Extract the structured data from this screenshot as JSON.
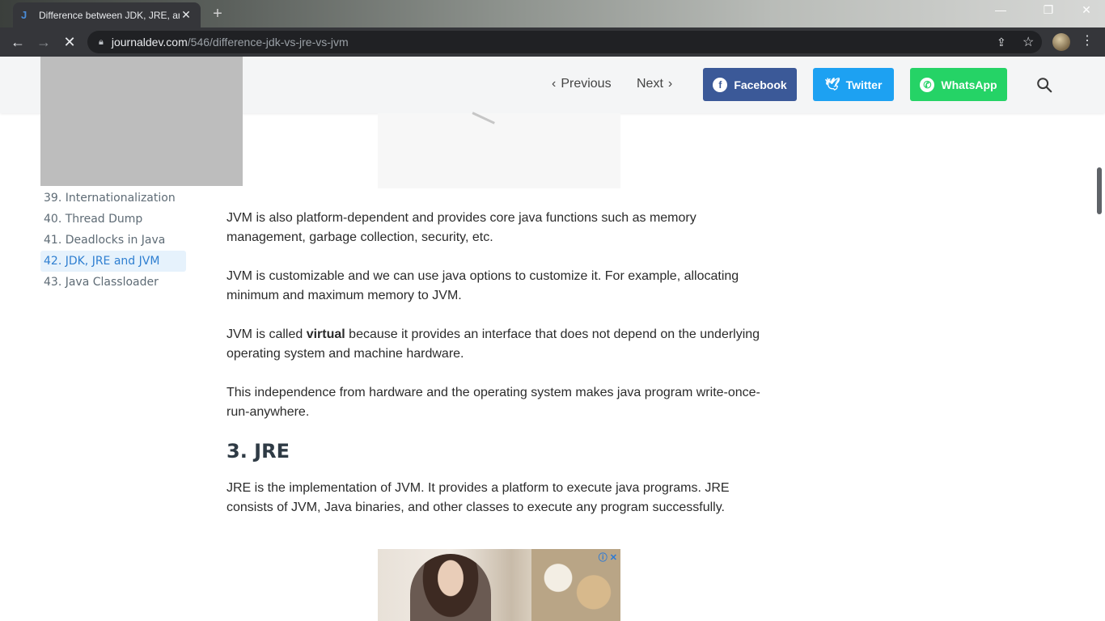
{
  "browser": {
    "tab_title": "Difference between JDK, JRE, and",
    "tab_close": "✕",
    "new_tab": "+",
    "url_host": "journaldev.com",
    "url_path": "/546/difference-jdk-vs-jre-vs-jvm"
  },
  "header": {
    "previous_label": "Previous",
    "next_label": "Next",
    "share": {
      "facebook": "Facebook",
      "twitter": "Twitter",
      "whatsapp": "WhatsApp"
    },
    "colors": {
      "facebook": "#3b5998",
      "twitter": "#1da1f2",
      "whatsapp": "#25d366"
    }
  },
  "sidebar": {
    "items": [
      {
        "label": "39. Internationalization",
        "active": false
      },
      {
        "label": "40. Thread Dump",
        "active": false
      },
      {
        "label": "41. Deadlocks in Java",
        "active": false
      },
      {
        "label": "42. JDK, JRE and JVM",
        "active": true
      },
      {
        "label": "43. Java Classloader",
        "active": false
      }
    ]
  },
  "article": {
    "p1": "JVM is also platform-dependent and provides core java functions such as memory management, garbage collection, security, etc.",
    "p2": "JVM is customizable and we can use java options to customize it. For example, allocating minimum and maximum memory to JVM.",
    "p3_before": "JVM is called ",
    "p3_bold": "virtual",
    "p3_after": " because it provides an interface that does not depend on the underlying operating system and machine hardware.",
    "p4": "This independence from hardware and the operating system makes java program write-once-run-anywhere.",
    "h2": "3. JRE",
    "p5": "JRE is the implementation of JVM. It provides a platform to execute java programs. JRE consists of JVM, Java binaries, and other classes to execute any program successfully."
  },
  "ad": {
    "adchoices": "ⓘ ✕"
  }
}
